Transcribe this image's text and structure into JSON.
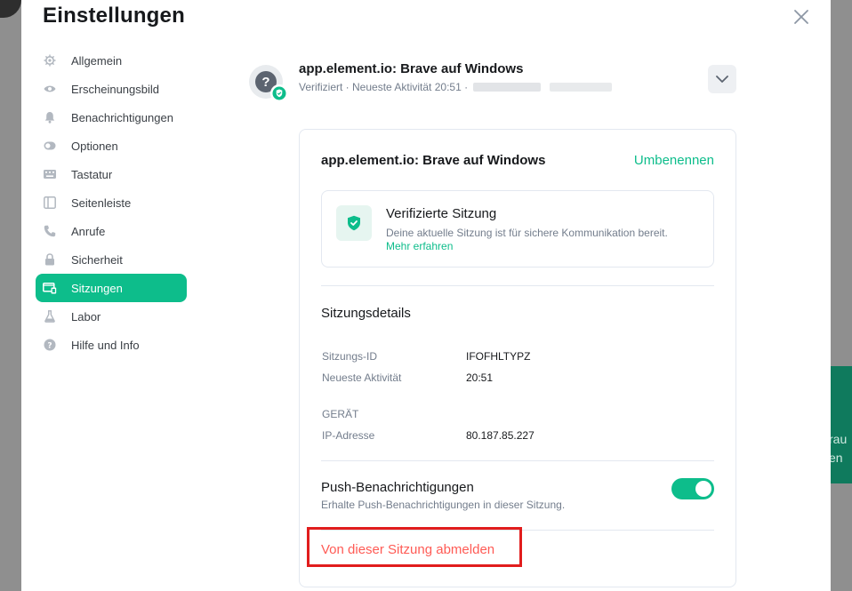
{
  "dialog": {
    "title": "Einstellungen"
  },
  "sidebar": {
    "items": [
      {
        "label": "Allgemein",
        "icon": "gear-icon",
        "active": false
      },
      {
        "label": "Erscheinungsbild",
        "icon": "eye-icon",
        "active": false
      },
      {
        "label": "Benachrichtigungen",
        "icon": "bell-icon",
        "active": false
      },
      {
        "label": "Optionen",
        "icon": "toggle-icon",
        "active": false
      },
      {
        "label": "Tastatur",
        "icon": "keyboard-icon",
        "active": false
      },
      {
        "label": "Seitenleiste",
        "icon": "sidebar-icon",
        "active": false
      },
      {
        "label": "Anrufe",
        "icon": "phone-icon",
        "active": false
      },
      {
        "label": "Sicherheit",
        "icon": "lock-icon",
        "active": false
      },
      {
        "label": "Sitzungen",
        "icon": "devices-icon",
        "active": true
      },
      {
        "label": "Labor",
        "icon": "flask-icon",
        "active": false
      },
      {
        "label": "Hilfe und Info",
        "icon": "help-icon",
        "active": false
      }
    ]
  },
  "session": {
    "name": "app.element.io: Brave auf Windows",
    "meta": "Verifiziert · Neueste Aktivität 20:51 ·",
    "avatar_glyph": "?"
  },
  "card": {
    "title": "app.element.io: Brave auf Windows",
    "rename_label": "Umbenennen",
    "verify_title": "Verifizierte Sitzung",
    "verify_desc": "Deine aktuelle Sitzung ist für sichere Kommunikation bereit.",
    "verify_link": "Mehr erfahren",
    "details_title": "Sitzungsdetails",
    "details": {
      "session_id_label": "Sitzungs-ID",
      "session_id_value": "IFOFHLTYPZ",
      "last_activity_label": "Neueste Aktivität",
      "last_activity_value": "20:51",
      "device_heading": "GERÄT",
      "ip_label": "IP-Adresse",
      "ip_value": "80.187.85.227"
    },
    "push_title": "Push-Benachrichtigungen",
    "push_desc": "Erhalte Push-Benachrichtigungen in dieser Sitzung.",
    "push_enabled": true,
    "signout_label": "Von dieser Sitzung abmelden"
  },
  "background": {
    "line1": "rau",
    "line2": "en"
  },
  "colors": {
    "accent": "#0dbd8b",
    "danger": "#ff5b55",
    "highlight_box": "#e11d1d"
  }
}
